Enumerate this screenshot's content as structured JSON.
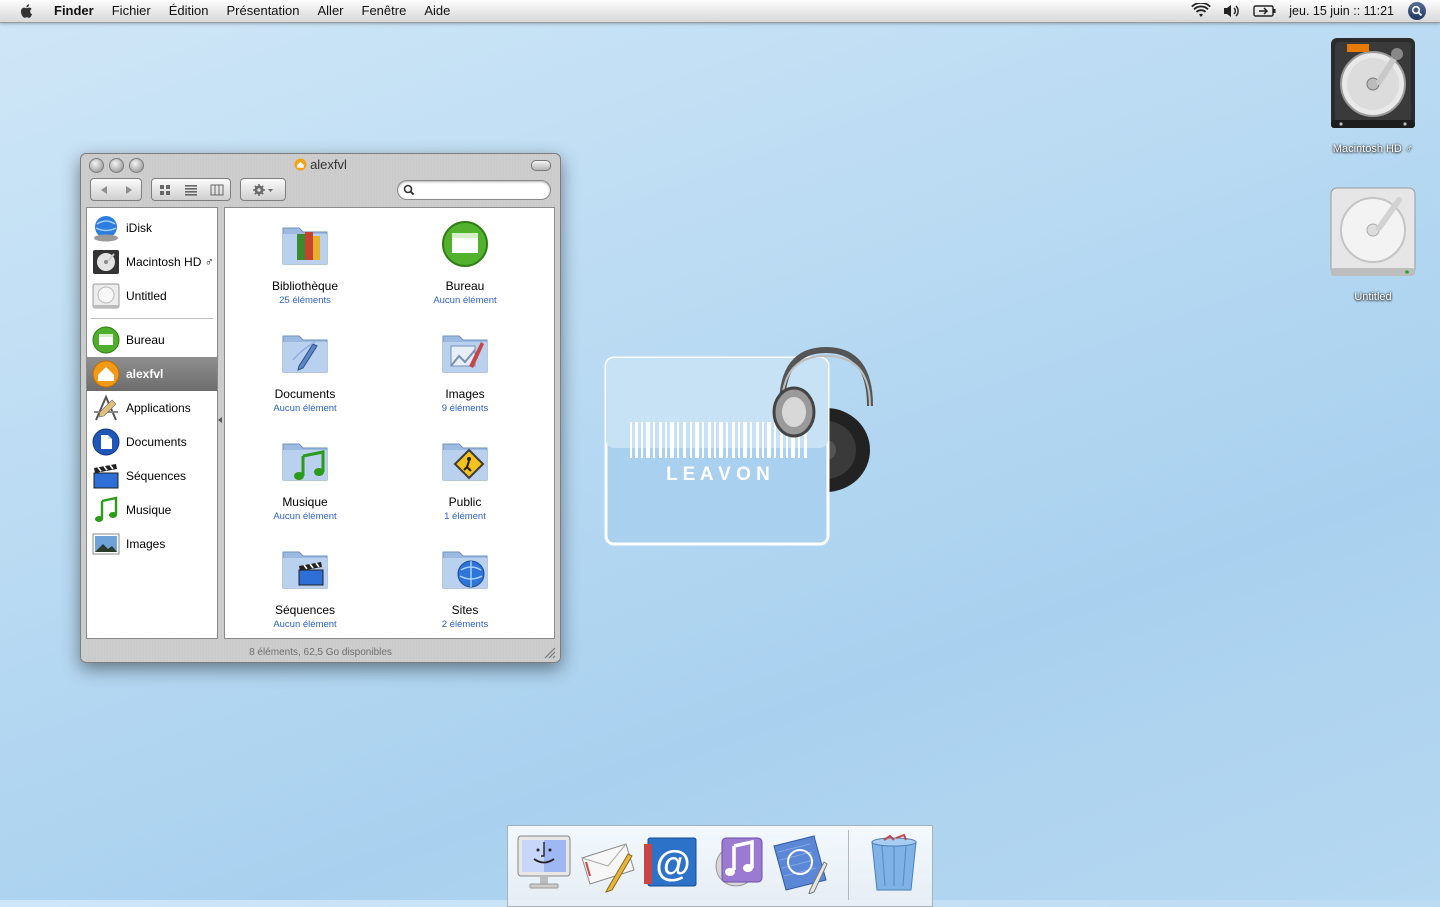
{
  "menubar": {
    "menus": [
      "Finder",
      "Fichier",
      "Édition",
      "Présentation",
      "Aller",
      "Fenêtre",
      "Aide"
    ],
    "clock": "jeu. 15 juin :: 11:21",
    "icons": [
      "apple-icon",
      "wifi-icon",
      "volume-icon",
      "battery-icon",
      "spotlight-icon"
    ]
  },
  "desktop": {
    "icons": [
      {
        "label": "Macintosh HD ♂"
      },
      {
        "label": "Untitled"
      }
    ]
  },
  "finder": {
    "title": "alexfvl",
    "search": {
      "value": "",
      "placeholder": ""
    },
    "sidebar": {
      "devices": [
        {
          "label": "iDisk",
          "icon": "idisk-icon"
        },
        {
          "label": "Macintosh HD ♂",
          "icon": "harddisk-icon"
        },
        {
          "label": "Untitled",
          "icon": "disk-icon"
        }
      ],
      "places": [
        {
          "label": "Bureau",
          "icon": "desktop-icon"
        },
        {
          "label": "alexfvl",
          "icon": "home-icon",
          "selected": true
        },
        {
          "label": "Applications",
          "icon": "applications-icon"
        },
        {
          "label": "Documents",
          "icon": "documents-icon"
        },
        {
          "label": "Séquences",
          "icon": "movies-icon"
        },
        {
          "label": "Musique",
          "icon": "music-icon"
        },
        {
          "label": "Images",
          "icon": "pictures-icon"
        }
      ]
    },
    "items": [
      {
        "name": "Bibliothèque",
        "sub": "25 éléments",
        "icon": "library-folder-icon"
      },
      {
        "name": "Bureau",
        "sub": "Aucun élément",
        "icon": "desktop-folder-icon"
      },
      {
        "name": "Documents",
        "sub": "Aucun élément",
        "icon": "documents-folder-icon"
      },
      {
        "name": "Images",
        "sub": "9 éléments",
        "icon": "pictures-folder-icon"
      },
      {
        "name": "Musique",
        "sub": "Aucun élément",
        "icon": "music-folder-icon"
      },
      {
        "name": "Public",
        "sub": "1 élément",
        "icon": "public-folder-icon"
      },
      {
        "name": "Séquences",
        "sub": "Aucun élément",
        "icon": "movies-folder-icon"
      },
      {
        "name": "Sites",
        "sub": "2 éléments",
        "icon": "sites-folder-icon"
      }
    ],
    "status": "8 éléments, 62,5 Go disponibles"
  },
  "widget": {
    "logo_text": "L E A V O N"
  },
  "dock": {
    "items": [
      "finder-icon",
      "mail-icon",
      "email-app-icon",
      "itunes-icon",
      "preview-icon",
      "trash-icon"
    ]
  },
  "colors": {
    "accent": "#2c62c6",
    "selection": "#777777"
  }
}
